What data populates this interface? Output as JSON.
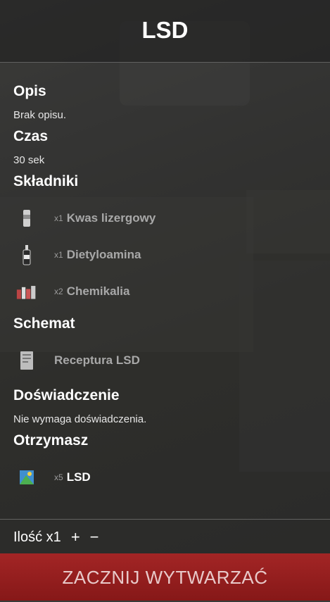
{
  "header": {
    "title": "LSD"
  },
  "sections": {
    "description": {
      "heading": "Opis",
      "text": "Brak opisu."
    },
    "time": {
      "heading": "Czas",
      "text": "30 sek"
    },
    "ingredients": {
      "heading": "Składniki",
      "items": [
        {
          "qty": "x1",
          "name": "Kwas lizergowy",
          "icon": "vial-icon"
        },
        {
          "qty": "x1",
          "name": "Dietyloamina",
          "icon": "bottle-icon"
        },
        {
          "qty": "x2",
          "name": "Chemikalia",
          "icon": "chemicals-icon"
        }
      ]
    },
    "blueprint": {
      "heading": "Schemat",
      "name": "Receptura LSD",
      "icon": "recipe-card-icon"
    },
    "experience": {
      "heading": "Doświadczenie",
      "text": "Nie wymaga doświadczenia."
    },
    "output": {
      "heading": "Otrzymasz",
      "items": [
        {
          "qty": "x5",
          "name": "LSD",
          "icon": "lsd-tab-icon"
        }
      ]
    }
  },
  "footer": {
    "quantity_label": "Ilość x1",
    "plus": "+",
    "minus": "−",
    "start_button": "ZACZNIJ WYTWARZAĆ"
  },
  "colors": {
    "accent": "#9b2020",
    "text": "#ffffff",
    "muted": "#a8a8a8"
  }
}
